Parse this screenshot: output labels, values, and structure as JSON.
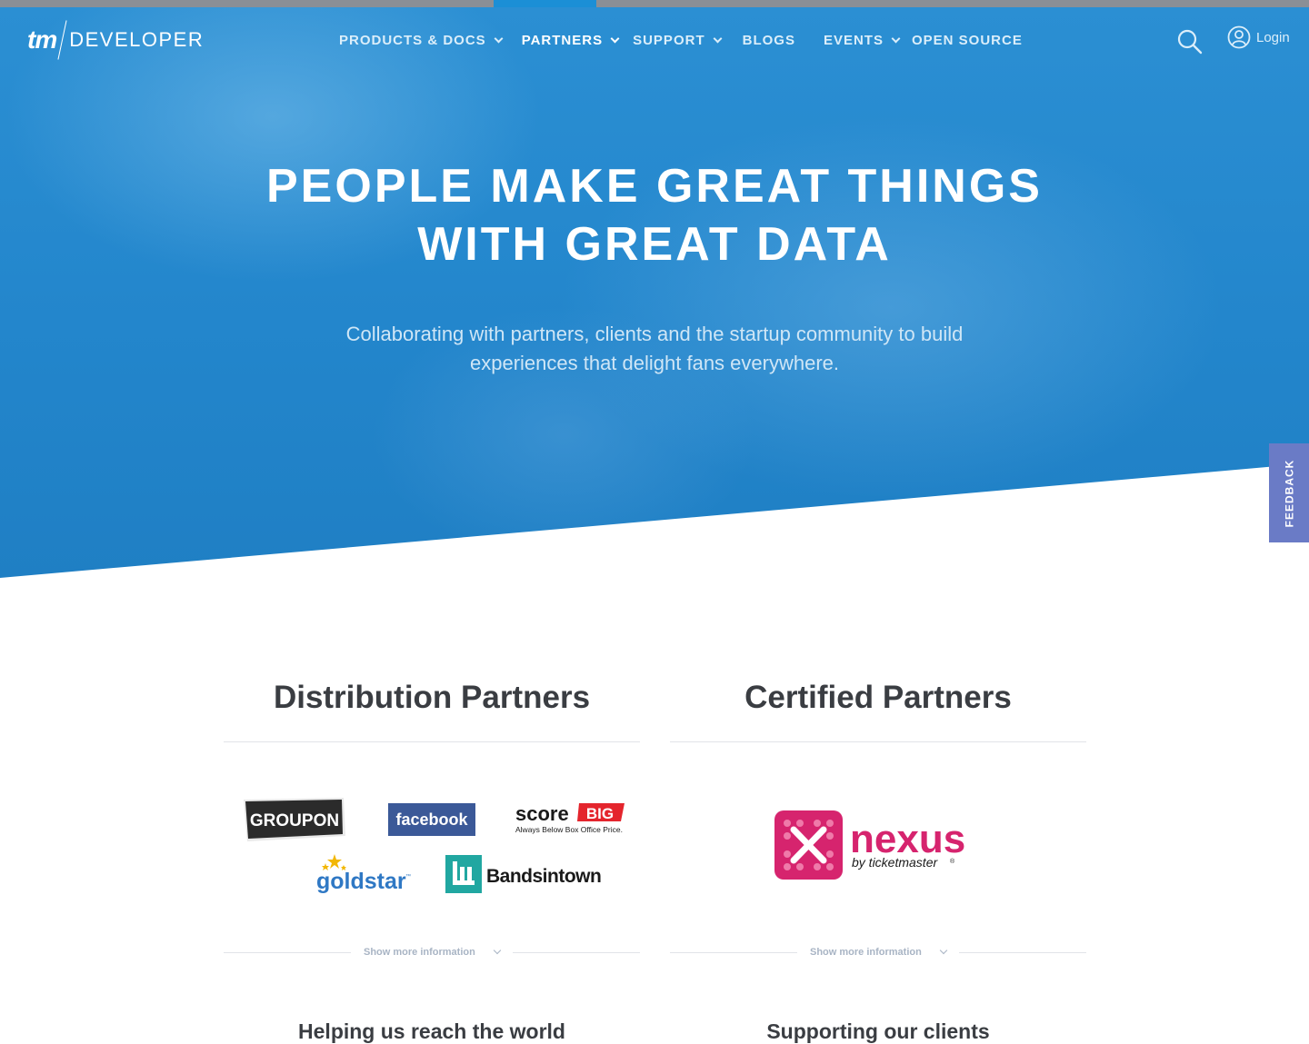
{
  "brand": {
    "logo_tm": "tm",
    "logo_text": "DEVELOPER"
  },
  "nav": {
    "items": [
      {
        "label": "PRODUCTS & DOCS",
        "has_dropdown": true,
        "active": false
      },
      {
        "label": "PARTNERS",
        "has_dropdown": true,
        "active": true
      },
      {
        "label": "SUPPORT",
        "has_dropdown": true,
        "active": false
      },
      {
        "label": "BLOGS",
        "has_dropdown": false,
        "active": false
      },
      {
        "label": "EVENTS",
        "has_dropdown": true,
        "active": false
      },
      {
        "label": "OPEN SOURCE",
        "has_dropdown": false,
        "active": false
      }
    ],
    "search_icon": "search-icon",
    "login_label": "Login"
  },
  "hero": {
    "title_line1": "PEOPLE MAKE GREAT THINGS",
    "title_line2": "WITH GREAT DATA",
    "subtitle_line1": "Collaborating with partners, clients and the startup community to build",
    "subtitle_line2": "experiences that delight fans everywhere."
  },
  "feedback_label": "FEEDBACK",
  "distribution": {
    "title": "Distribution Partners",
    "logos": [
      {
        "name": "GROUPON"
      },
      {
        "name": "facebook"
      },
      {
        "name": "score",
        "accent": "BIG",
        "tagline": "Always Below Box Office Price."
      },
      {
        "name": "goldstar",
        "mark": "™"
      },
      {
        "name": "Bandsintown"
      }
    ],
    "show_more": "Show more information",
    "subheading": "Helping us reach the world"
  },
  "certified": {
    "title": "Certified Partners",
    "logos": [
      {
        "name": "nexus",
        "byline": "by ticketmaster",
        "mark": "®"
      }
    ],
    "show_more": "Show more information",
    "subheading": "Supporting our clients"
  },
  "colors": {
    "hero_blue": "#2386cc",
    "nav_active_strip": "#1b8fd6",
    "feedback_purple": "#6a7bc6",
    "heading_dark": "#3a3d42",
    "groupon_dark": "#2b2b2b",
    "facebook_blue": "#3b5998",
    "scorebig_red": "#e4252d",
    "goldstar_blue": "#2f78c4",
    "bandsintown_teal": "#21a7a1",
    "nexus_pink": "#d6246e"
  }
}
